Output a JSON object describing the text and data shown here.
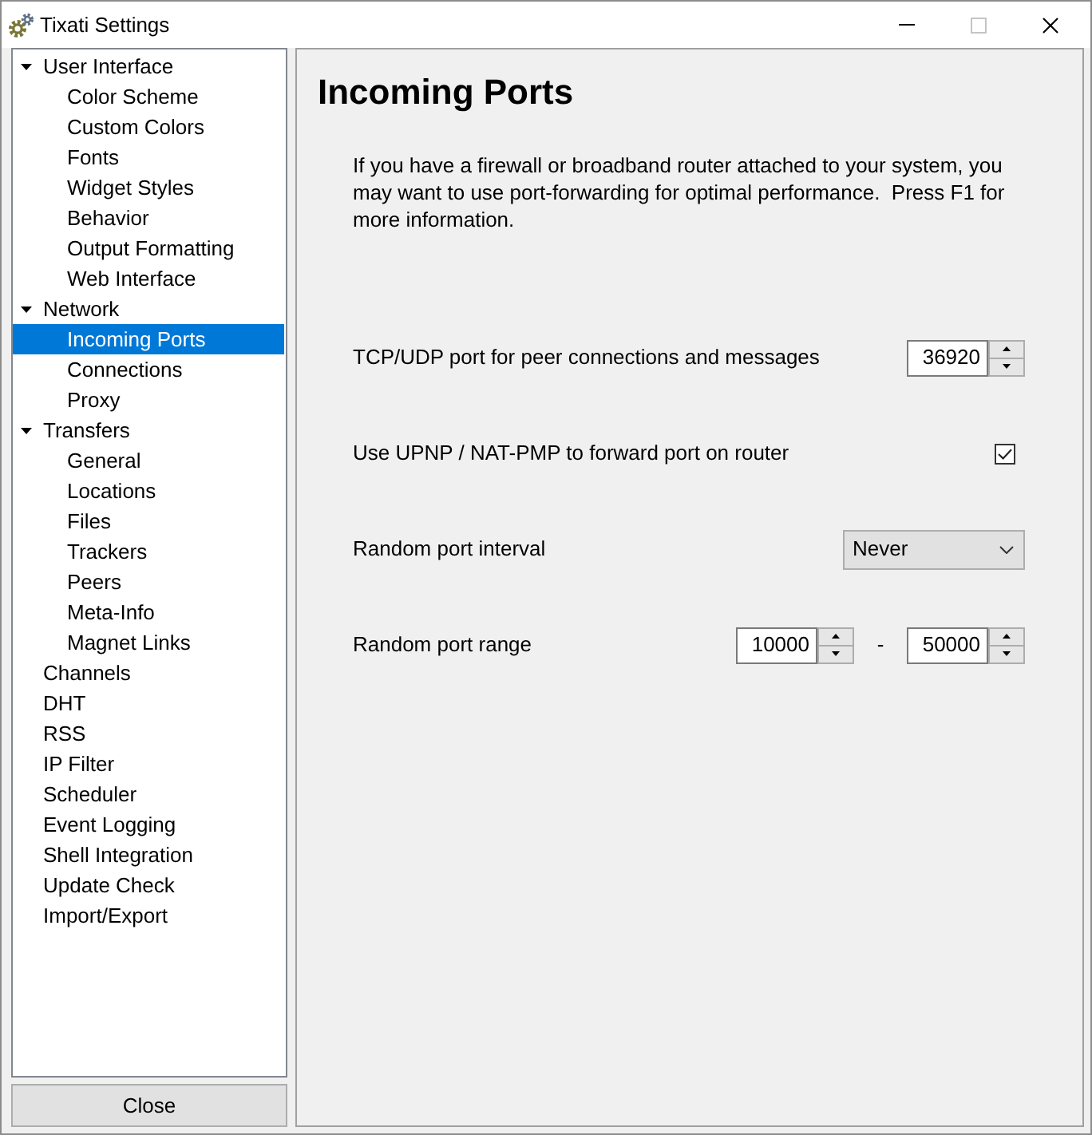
{
  "window": {
    "title": "Tixati Settings",
    "controls": [
      {
        "kind": "minimize",
        "disabled": false
      },
      {
        "kind": "maximize",
        "disabled": true
      },
      {
        "kind": "close",
        "disabled": false
      }
    ]
  },
  "sidebar": {
    "items": [
      {
        "label": "User Interface",
        "selected": false,
        "expanded": true,
        "children": [
          {
            "label": "Color Scheme",
            "selected": false
          },
          {
            "label": "Custom Colors",
            "selected": false
          },
          {
            "label": "Fonts",
            "selected": false
          },
          {
            "label": "Widget Styles",
            "selected": false
          },
          {
            "label": "Behavior",
            "selected": false
          },
          {
            "label": "Output Formatting",
            "selected": false
          },
          {
            "label": "Web Interface",
            "selected": false
          }
        ]
      },
      {
        "label": "Network",
        "selected": false,
        "expanded": true,
        "children": [
          {
            "label": "Incoming Ports",
            "selected": true
          },
          {
            "label": "Connections",
            "selected": false
          },
          {
            "label": "Proxy",
            "selected": false
          }
        ]
      },
      {
        "label": "Transfers",
        "selected": false,
        "expanded": true,
        "children": [
          {
            "label": "General",
            "selected": false
          },
          {
            "label": "Locations",
            "selected": false
          },
          {
            "label": "Files",
            "selected": false
          },
          {
            "label": "Trackers",
            "selected": false
          },
          {
            "label": "Peers",
            "selected": false
          },
          {
            "label": "Meta-Info",
            "selected": false
          },
          {
            "label": "Magnet Links",
            "selected": false
          }
        ]
      },
      {
        "label": "Channels",
        "selected": false
      },
      {
        "label": "DHT",
        "selected": false
      },
      {
        "label": "RSS",
        "selected": false
      },
      {
        "label": "IP Filter",
        "selected": false
      },
      {
        "label": "Scheduler",
        "selected": false
      },
      {
        "label": "Event Logging",
        "selected": false
      },
      {
        "label": "Shell Integration",
        "selected": false
      },
      {
        "label": "Update Check",
        "selected": false
      },
      {
        "label": "Import/Export",
        "selected": false
      }
    ]
  },
  "close_button": {
    "label": "Close"
  },
  "page": {
    "heading": "Incoming Ports",
    "description": "If you have a firewall or broadband router attached to your system, you may want to use port-forwarding for optimal performance.  Press F1 for more information.",
    "settings": [
      {
        "kind": "spinbox",
        "label": "TCP/UDP port for peer connections and messages",
        "value": "36920"
      },
      {
        "kind": "checkbox",
        "label": "Use UPNP / NAT-PMP to forward port on router",
        "checked": true
      },
      {
        "kind": "dropdown",
        "label": "Random port interval",
        "value": "Never"
      },
      {
        "kind": "range",
        "label": "Random port range",
        "from": "10000",
        "separator": "-",
        "to": "50000"
      }
    ]
  }
}
